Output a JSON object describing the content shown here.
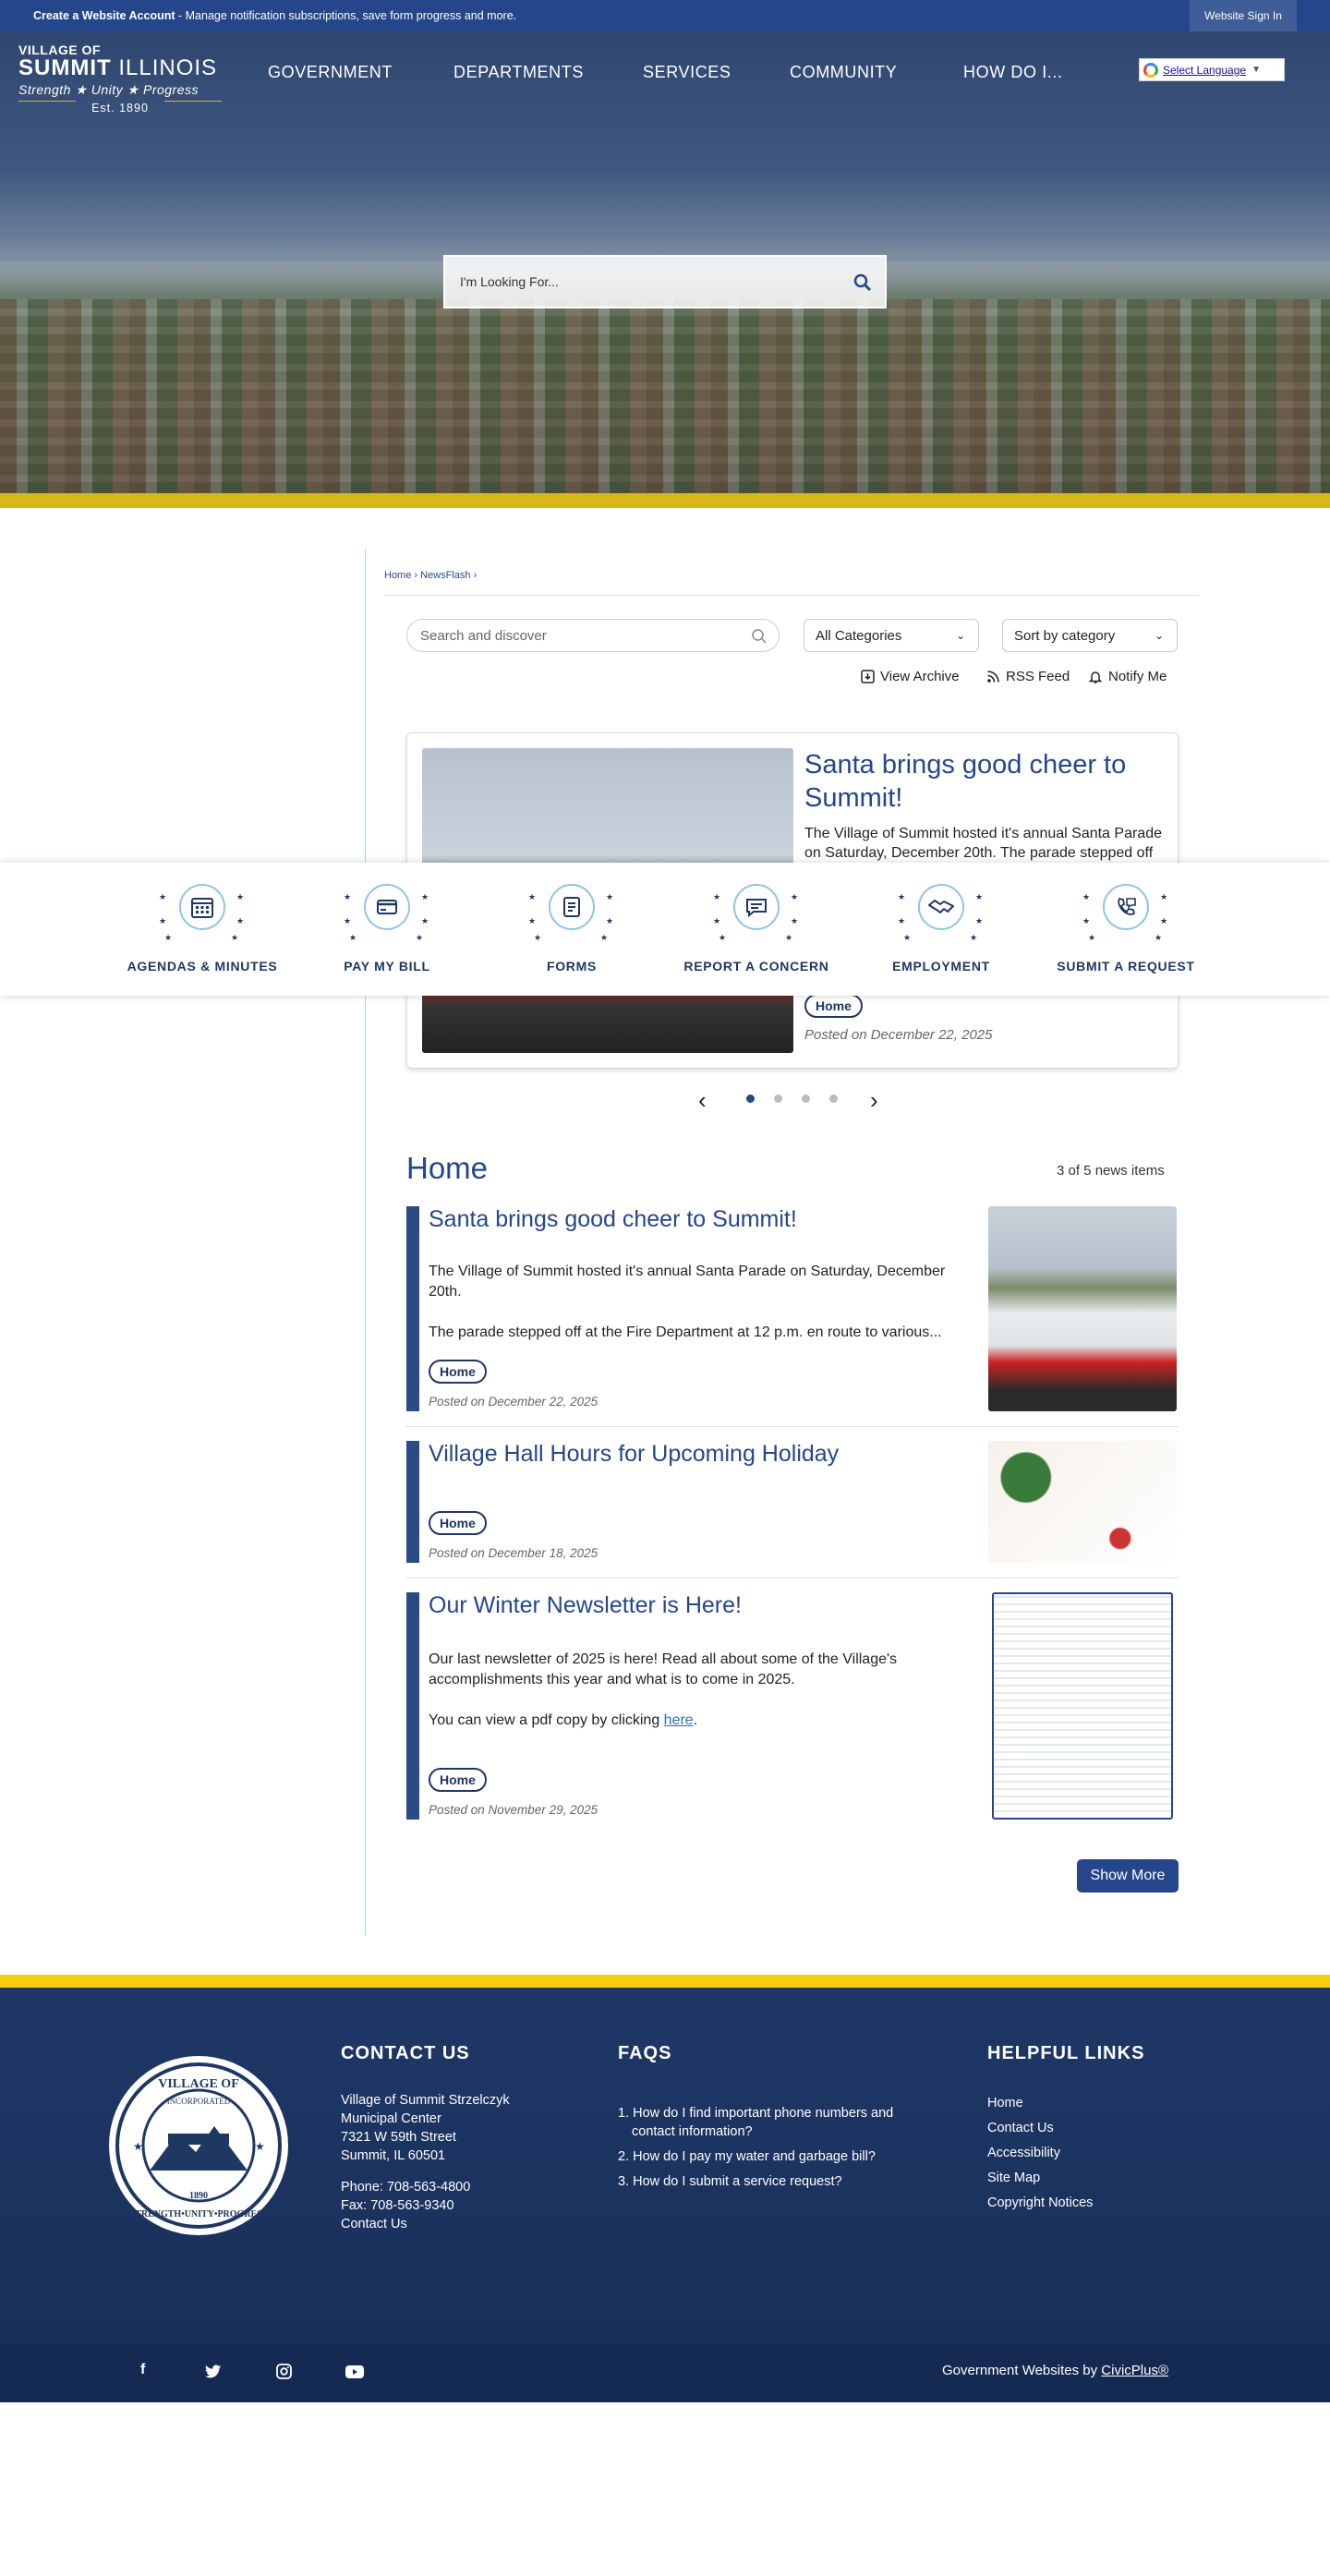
{
  "topbar": {
    "create_account": "Create a Website Account",
    "message": " - Manage notification subscriptions, save form progress and more.",
    "sign_in": "Website Sign In"
  },
  "logo": {
    "line1": "VILLAGE OF",
    "line2a": "SUMMIT",
    "line2b": " ILLINOIS",
    "line3": "Strength ★ Unity ★ Progress",
    "line4": "Est. 1890"
  },
  "nav": {
    "government": "GOVERNMENT",
    "departments": "DEPARTMENTS",
    "services": "SERVICES",
    "community": "COMMUNITY",
    "how_do_i": "HOW DO I..."
  },
  "translate": {
    "label": "Select Language",
    "arrow": "▼"
  },
  "hero_search": {
    "placeholder": "I'm Looking For..."
  },
  "breadcrumb": {
    "home": "Home",
    "sep": " › ",
    "newsflash": "NewsFlash",
    "tail": " ›"
  },
  "filters": {
    "search_placeholder": "Search and discover",
    "category": "All Categories",
    "sort": "Sort by category"
  },
  "tools": {
    "archive": "View Archive",
    "rss": "RSS Feed",
    "notify": "Notify Me"
  },
  "carousel": {
    "title": "Santa brings good cheer to Summit!",
    "text": "The Village of Summit hosted it's annual Santa Parade on Saturday, December 20th. The parade stepped off at the Fire Department at 12 p.m.",
    "tag": "Home",
    "date": "Posted on December 22, 2025",
    "prev": "‹",
    "next": "›",
    "active_slide": 1,
    "slide_count": 4
  },
  "quick_links": [
    {
      "label": "AGENDAS & MINUTES",
      "icon": "calendar-icon"
    },
    {
      "label": "PAY MY BILL",
      "icon": "credit-card-icon"
    },
    {
      "label": "FORMS",
      "icon": "form-icon"
    },
    {
      "label": "REPORT A CONCERN",
      "icon": "chat-icon"
    },
    {
      "label": "EMPLOYMENT",
      "icon": "handshake-icon"
    },
    {
      "label": "SUBMIT A REQUEST",
      "icon": "phone-request-icon"
    }
  ],
  "news": {
    "heading": "Home",
    "count": "3 of 5 news items",
    "items": [
      {
        "title": "Santa brings good cheer to Summit!",
        "p1": "The Village of Summit hosted it's annual Santa Parade on Saturday, December 20th.",
        "p2": "The parade stepped off at the Fire Department at 12 p.m. en route to various...",
        "tag": "Home",
        "date": "Posted on December 22, 2025"
      },
      {
        "title": "Village Hall Hours for Upcoming Holiday",
        "tag": "Home",
        "date": "Posted on December 18, 2025"
      },
      {
        "title": "Our Winter Newsletter is Here!",
        "p1": "Our last newsletter of 2025 is here! Read all about some of the Village's accomplishments this year and what is to come in 2025.",
        "p2a": "You can view a pdf copy by clicking ",
        "p2link": "here",
        "p2b": ".",
        "tag": "Home",
        "date": "Posted on November 29, 2025"
      }
    ],
    "show_more": "Show More"
  },
  "footer": {
    "contact_heading": "CONTACT US",
    "contact_lines": [
      "Village of Summit Strzelczyk",
      "Municipal Center",
      "7321 W 59th Street",
      "Summit, IL 60501"
    ],
    "phone": "Phone: 708-563-4800",
    "fax": "Fax: 708-563-9340",
    "contact_link": "Contact Us",
    "faqs_heading": "FAQS",
    "faqs": [
      {
        "num": "1.",
        "line1": "How do I find important phone numbers and",
        "line2": "contact information?"
      },
      {
        "num": "2.",
        "line1": "How do I pay my water and garbage bill?"
      },
      {
        "num": "3.",
        "line1": "How do I submit a service request?"
      }
    ],
    "helpful_heading": "HELPFUL LINKS",
    "helpful": [
      "Home",
      "Contact Us",
      "Accessibility",
      "Site Map",
      "Copyright Notices"
    ],
    "seal_top": "VILLAGE OF",
    "seal_mid": "INCORPORATED",
    "seal_year": "1890",
    "seal_bottom": "STRENGTH•UNITY•PROGRESS",
    "social": [
      "f",
      "t",
      "ig",
      "yt"
    ],
    "powered_prefix": "Government Websites by ",
    "powered_link": "CivicPlus®"
  }
}
